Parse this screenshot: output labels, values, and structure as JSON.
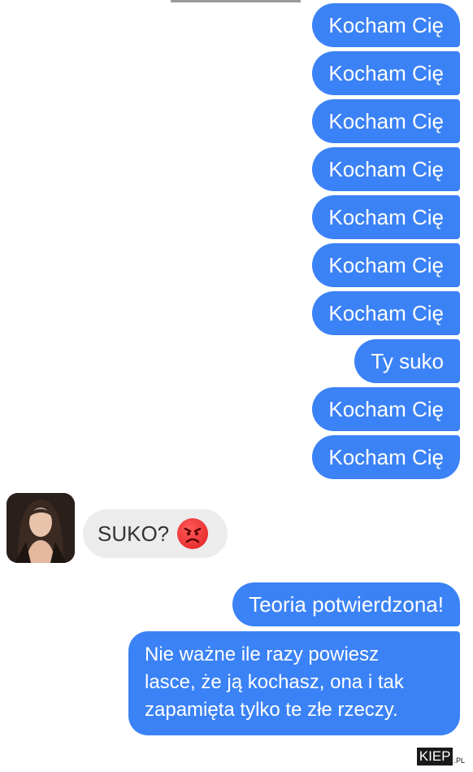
{
  "chat": {
    "outgoing_top": [
      "Kocham Cię",
      "Kocham Cię",
      "Kocham Cię",
      "Kocham Cię",
      "Kocham Cię",
      "Kocham Cię",
      "Kocham Cię",
      "Ty suko",
      "Kocham Cię",
      "Kocham Cię"
    ],
    "incoming": {
      "text": "SUKO?",
      "emoji": "angry-face-icon"
    },
    "outgoing_bottom": {
      "short": "Teoria potwierdzona!",
      "long_lines": [
        "Nie ważne ile razy powiesz",
        "lasce, że ją kochasz, ona i tak",
        "zapamięta tylko te złe rzeczy."
      ]
    }
  },
  "watermark": {
    "main": "KIEP",
    "suffix": ".PL"
  },
  "colors": {
    "outgoing_bubble": "#3b82f6",
    "incoming_bubble": "#ececec"
  }
}
